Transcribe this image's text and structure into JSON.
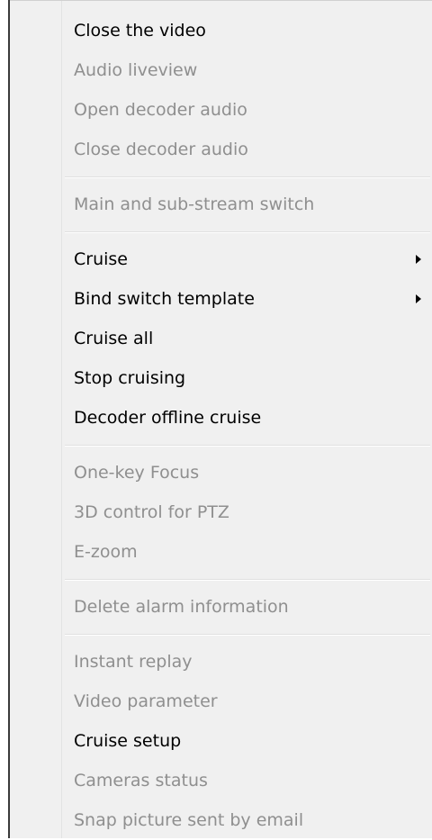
{
  "menu": {
    "items": [
      {
        "type": "item",
        "name": "menu-item-close-video",
        "label": "Close the video",
        "enabled": true,
        "submenu": false
      },
      {
        "type": "item",
        "name": "menu-item-audio-liveview",
        "label": "Audio liveview",
        "enabled": false,
        "submenu": false
      },
      {
        "type": "item",
        "name": "menu-item-open-decoder-audio",
        "label": "Open decoder audio",
        "enabled": false,
        "submenu": false
      },
      {
        "type": "item",
        "name": "menu-item-close-decoder-audio",
        "label": "Close decoder audio",
        "enabled": false,
        "submenu": false
      },
      {
        "type": "separator"
      },
      {
        "type": "item",
        "name": "menu-item-stream-switch",
        "label": "Main and sub-stream switch",
        "enabled": false,
        "submenu": false
      },
      {
        "type": "separator"
      },
      {
        "type": "item",
        "name": "menu-item-cruise",
        "label": "Cruise",
        "enabled": true,
        "submenu": true
      },
      {
        "type": "item",
        "name": "menu-item-bind-switch-template",
        "label": "Bind switch template",
        "enabled": true,
        "submenu": true
      },
      {
        "type": "item",
        "name": "menu-item-cruise-all",
        "label": "Cruise all",
        "enabled": true,
        "submenu": false
      },
      {
        "type": "item",
        "name": "menu-item-stop-cruising",
        "label": "Stop cruising",
        "enabled": true,
        "submenu": false
      },
      {
        "type": "item",
        "name": "menu-item-decoder-offline-cruise",
        "label": "Decoder offline cruise",
        "enabled": true,
        "submenu": false
      },
      {
        "type": "separator"
      },
      {
        "type": "item",
        "name": "menu-item-one-key-focus",
        "label": "One-key Focus",
        "enabled": false,
        "submenu": false
      },
      {
        "type": "item",
        "name": "menu-item-3d-control-ptz",
        "label": "3D control for PTZ",
        "enabled": false,
        "submenu": false
      },
      {
        "type": "item",
        "name": "menu-item-e-zoom",
        "label": "E-zoom",
        "enabled": false,
        "submenu": false
      },
      {
        "type": "separator"
      },
      {
        "type": "item",
        "name": "menu-item-delete-alarm-info",
        "label": "Delete alarm information",
        "enabled": false,
        "submenu": false
      },
      {
        "type": "separator"
      },
      {
        "type": "item",
        "name": "menu-item-instant-replay",
        "label": "Instant replay",
        "enabled": false,
        "submenu": false
      },
      {
        "type": "item",
        "name": "menu-item-video-parameter",
        "label": "Video parameter",
        "enabled": false,
        "submenu": false
      },
      {
        "type": "item",
        "name": "menu-item-cruise-setup",
        "label": "Cruise setup",
        "enabled": true,
        "submenu": false
      },
      {
        "type": "item",
        "name": "menu-item-cameras-status",
        "label": "Cameras status",
        "enabled": false,
        "submenu": false
      },
      {
        "type": "item",
        "name": "menu-item-snap-picture-email",
        "label": "Snap picture sent by email",
        "enabled": false,
        "submenu": false
      }
    ],
    "colors": {
      "enabled_text": "#000000",
      "disabled_text": "#8f8f8f",
      "background": "#f0f0f0"
    }
  }
}
